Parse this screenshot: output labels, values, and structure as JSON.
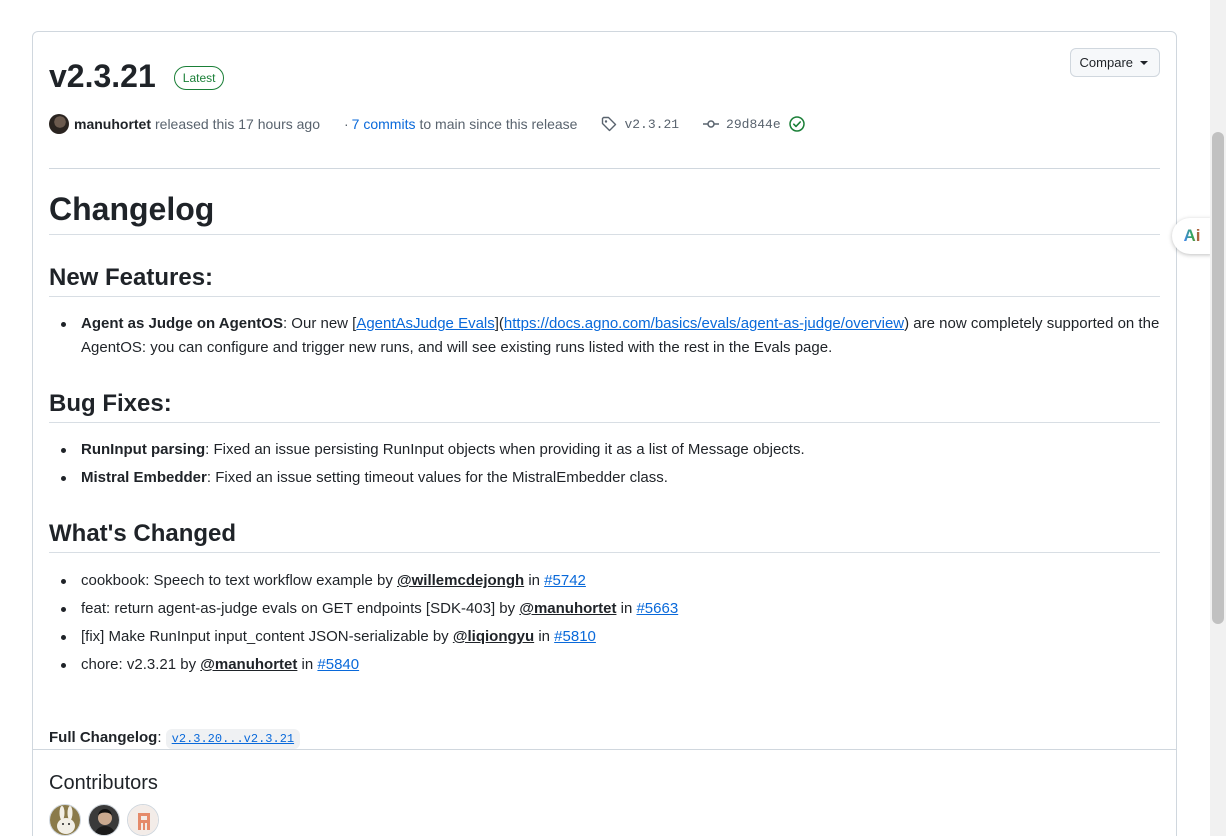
{
  "release": {
    "version": "v2.3.21",
    "badge": "Latest",
    "compare_label": "Compare",
    "author": "manuhortet",
    "released_text": "released this 17 hours ago",
    "commits_prefix": "·",
    "commits_link": "7 commits",
    "commits_suffix": "to main since this release",
    "tag": "v2.3.21",
    "commit_sha": "29d844e"
  },
  "changelog": {
    "title": "Changelog",
    "new_features": {
      "heading": "New Features:",
      "items": [
        {
          "bold": "Agent as Judge on AgentOS",
          "text1": ": Our new [",
          "link1": "AgentAsJudge Evals",
          "text2": "](",
          "link2": "https://docs.agno.com/basics/evals/agent-as-judge/overview",
          "text3": ") are now completely supported on the AgentOS: you can configure and trigger new runs, and will see existing runs listed with the rest in the Evals page."
        }
      ]
    },
    "bug_fixes": {
      "heading": "Bug Fixes:",
      "items": [
        {
          "bold": "RunInput parsing",
          "text": ": Fixed an issue persisting RunInput objects when providing it as a list of Message objects."
        },
        {
          "bold": "Mistral Embedder",
          "text": ": Fixed an issue setting timeout values for the MistralEmbedder class."
        }
      ]
    },
    "whats_changed": {
      "heading": "What's Changed",
      "items": [
        {
          "text": "cookbook: Speech to text workflow example by ",
          "user": "@willemcdejongh",
          "in": " in ",
          "pr": "#5742"
        },
        {
          "text": "feat: return agent-as-judge evals on GET endpoints [SDK-403] by ",
          "user": "@manuhortet",
          "in": " in ",
          "pr": "#5663"
        },
        {
          "text": "[fix] Make RunInput input_content JSON-serializable by ",
          "user": "@liqiongyu",
          "in": " in ",
          "pr": "#5810"
        },
        {
          "text": "chore: v2.3.21 by ",
          "user": "@manuhortet",
          "in": " in ",
          "pr": "#5840"
        }
      ]
    },
    "full_changelog_label": "Full Changelog",
    "full_changelog_sep": ":",
    "full_changelog_link": "v2.3.20...v2.3.21"
  },
  "contributors": {
    "title": "Contributors"
  },
  "side_button": {
    "label": "Ai"
  },
  "colors": {
    "accent": "#0969da",
    "success": "#1a7f37",
    "border": "#d0d7de"
  },
  "icons": [
    "tag-icon",
    "git-commit-icon",
    "verified-check-icon",
    "caret-down-icon"
  ]
}
